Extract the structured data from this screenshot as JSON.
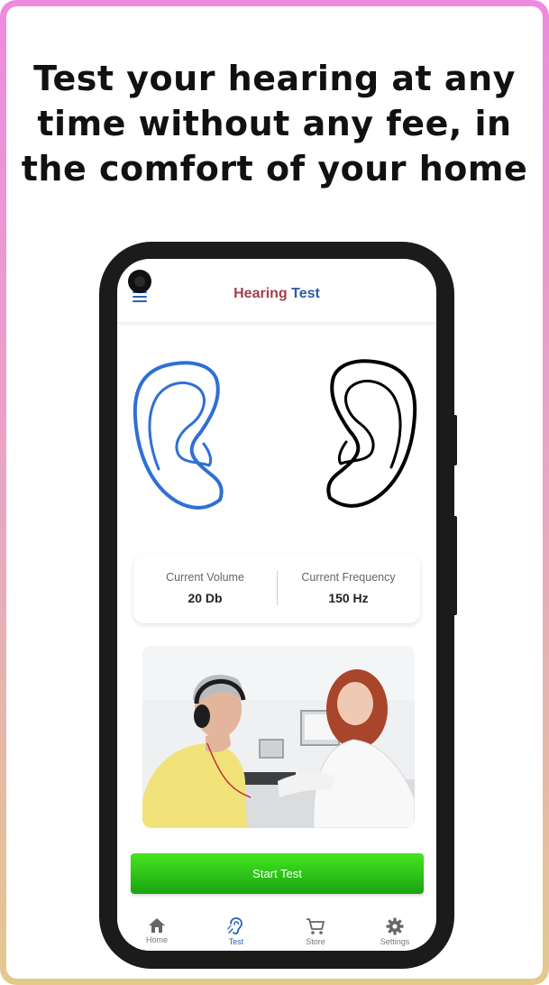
{
  "headline": {
    "line1": "Test your hearing at any",
    "line2": "time without any fee, in",
    "line3": "the comfort of your home"
  },
  "appbar": {
    "title_part1": "Hearing",
    "title_part2": "Test",
    "menu_icon": "hamburger-menu-icon"
  },
  "ears": {
    "left_color": "#2f6fd6",
    "right_color": "#000000"
  },
  "stats": {
    "volume_label": "Current Volume",
    "volume_value": "20 Db",
    "frequency_label": "Current Frequency",
    "frequency_value": "150 Hz"
  },
  "start_button": {
    "label": "Start Test",
    "color": "#2fc51a"
  },
  "bottom_nav": {
    "items": [
      {
        "label": "Home",
        "icon": "home-icon"
      },
      {
        "label": "Test",
        "icon": "hearing-icon",
        "active": true
      },
      {
        "label": "Store",
        "icon": "cart-icon"
      },
      {
        "label": "Settings",
        "icon": "gear-icon"
      }
    ],
    "active_color": "#2b62b8"
  }
}
